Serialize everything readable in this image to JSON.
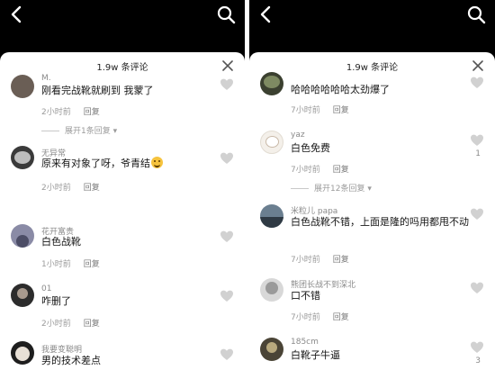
{
  "left": {
    "count_title": "1.9w 条评论",
    "comments": [
      {
        "username": "M.",
        "text": "刚看完战靴就刷到 我蒙了",
        "time": "2小时前",
        "reply": "回复",
        "expand": "展开1条回复"
      },
      {
        "username": "无异常",
        "text": "原来有对象了呀，爷青结",
        "time": "2小时前",
        "reply": "回复"
      },
      {
        "username": "花开富贵",
        "text": "白色战靴",
        "time": "1小时前",
        "reply": "回复"
      },
      {
        "username": "01",
        "text": "咋删了",
        "time": "2小时前",
        "reply": "回复"
      },
      {
        "username": "我要变聪明",
        "text": "男的技术差点"
      }
    ]
  },
  "right": {
    "count_title": "1.9w 条评论",
    "comments": [
      {
        "username": "",
        "text": "哈哈哈哈哈哈太劲爆了",
        "time": "7小时前",
        "reply": "回复"
      },
      {
        "username": "yaz",
        "text": "白色免费",
        "time": "7小时前",
        "reply": "回复",
        "likes": "1",
        "expand": "展开12条回复"
      },
      {
        "username": "米粒儿 papa",
        "text": "白色战靴不错，上面是隆的吗用都甩不动",
        "time": "7小时前",
        "reply": "回复"
      },
      {
        "username": "熊团长战不到深北",
        "text": "口不错",
        "time": "7小时前",
        "reply": "回复"
      },
      {
        "username": "185cm",
        "text": "白靴子牛逼",
        "likes": "3"
      }
    ]
  },
  "icons": {
    "back": "chevron-left-icon",
    "search": "search-icon",
    "close": "close-icon",
    "like": "heart-icon"
  },
  "colors": {
    "top_bar": "#000000",
    "sheet": "#ffffff",
    "meta_text": "#9b9b9b",
    "like_icon": "#cfcfcf"
  }
}
